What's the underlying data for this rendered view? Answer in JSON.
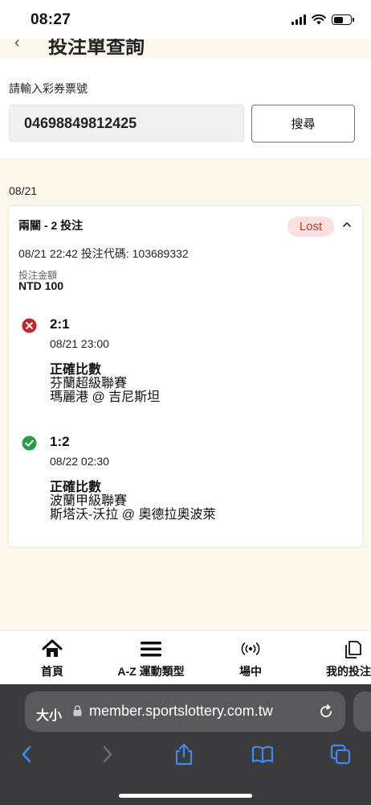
{
  "status_bar": {
    "time": "08:27"
  },
  "page": {
    "title": "投注單查詢"
  },
  "search": {
    "label": "請輸入彩券票號",
    "ticket_value": "04698849812425",
    "button_label": "搜尋"
  },
  "date_group": "08/21",
  "bet": {
    "title": "兩關 - 2 投注",
    "status": "Lost",
    "meta": "08/21 22:42 投注代碼: 103689332",
    "amount_label": "投注金額",
    "amount_value": "NTD 100",
    "selections": [
      {
        "result": "lost",
        "status_icon": "x-circle-icon",
        "score": "2:1",
        "time": "08/21 23:00",
        "market": "正確比數",
        "league": "芬蘭超級聯賽",
        "teams": "瑪麗港 @ 吉尼斯坦"
      },
      {
        "result": "won",
        "status_icon": "check-circle-icon",
        "score": "1:2",
        "time": "08/22 02:30",
        "market": "正確比數",
        "league": "波蘭甲級聯賽",
        "teams": "斯塔沃-沃拉 @ 奧德拉奧波萊"
      }
    ]
  },
  "bottom_nav": [
    {
      "label": "首頁",
      "icon": "home-icon"
    },
    {
      "label": "A-Z 運動類型",
      "icon": "menu-icon"
    },
    {
      "label": "場中",
      "icon": "live-broadcast-icon"
    },
    {
      "label": "我的投注",
      "icon": "copy-pages-icon"
    }
  ],
  "browser": {
    "text_size_label": "大小",
    "url": "member.sportslottery.com.tw"
  },
  "colors": {
    "page_bg": "#fdf8ec",
    "lost_badge_bg": "#fbe0e0",
    "lost_badge_text": "#c0392b",
    "lost_icon": "#c0282d",
    "won_icon": "#2e9a48",
    "browser_accent": "#3d8bf2"
  }
}
